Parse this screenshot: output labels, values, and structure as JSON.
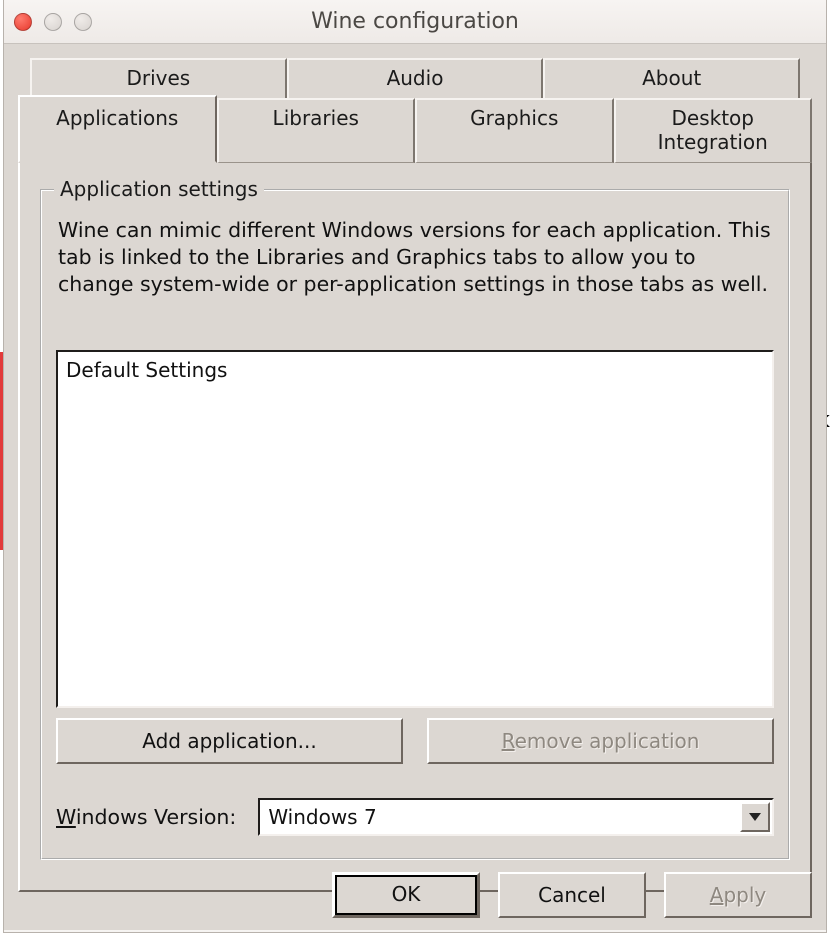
{
  "window": {
    "title": "Wine configuration"
  },
  "tabs": {
    "row1": [
      {
        "id": "drives",
        "label": "Drives"
      },
      {
        "id": "audio",
        "label": "Audio"
      },
      {
        "id": "about",
        "label": "About"
      }
    ],
    "row2": [
      {
        "id": "applications",
        "label": "Applications"
      },
      {
        "id": "libraries",
        "label": "Libraries"
      },
      {
        "id": "graphics",
        "label": "Graphics"
      },
      {
        "id": "desktop",
        "label": "Desktop Integration"
      }
    ],
    "active": "applications"
  },
  "group": {
    "legend": "Application settings",
    "description": "Wine can mimic different Windows versions for each application. This tab is linked to the Libraries and Graphics tabs to allow you to change system-wide or per-application settings in those tabs as well."
  },
  "list": {
    "items": [
      "Default Settings"
    ]
  },
  "buttons": {
    "add": "Add application...",
    "remove_pre": "R",
    "remove_post": "emove application"
  },
  "version": {
    "label_pre": "W",
    "label_post": "indows Version:",
    "value": "Windows 7"
  },
  "footer": {
    "ok": "OK",
    "cancel": "Cancel",
    "apply_pre": "A",
    "apply_post": "pply"
  }
}
